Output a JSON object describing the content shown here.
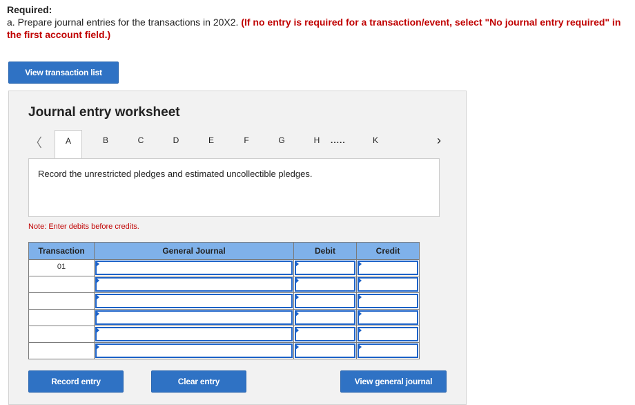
{
  "required": {
    "label": "Required:",
    "instruction": "a. Prepare journal entries for the transactions in 20X2.",
    "hint": "(If no entry is required for a transaction/event, select \"No journal entry required\" in the first account field.)"
  },
  "buttons": {
    "view_transaction_list": "View transaction list",
    "record_entry": "Record entry",
    "clear_entry": "Clear entry",
    "view_general_journal": "View general journal"
  },
  "worksheet": {
    "title": "Journal entry worksheet",
    "tabs": [
      "A",
      "B",
      "C",
      "D",
      "E",
      "F",
      "G",
      "H",
      "K"
    ],
    "active_tab": "A",
    "ellipsis": ".....",
    "description": "Record the unrestricted pledges and estimated uncollectible pledges.",
    "note": "Note: Enter debits before credits."
  },
  "table": {
    "headers": {
      "transaction": "Transaction",
      "general_journal": "General Journal",
      "debit": "Debit",
      "credit": "Credit"
    },
    "rows": [
      {
        "transaction": "01"
      },
      {
        "transaction": ""
      },
      {
        "transaction": ""
      },
      {
        "transaction": ""
      },
      {
        "transaction": ""
      },
      {
        "transaction": ""
      }
    ]
  },
  "colors": {
    "accent_button": "#2f72c4",
    "table_header": "#7fb1ea",
    "hint_red": "#c00000"
  }
}
